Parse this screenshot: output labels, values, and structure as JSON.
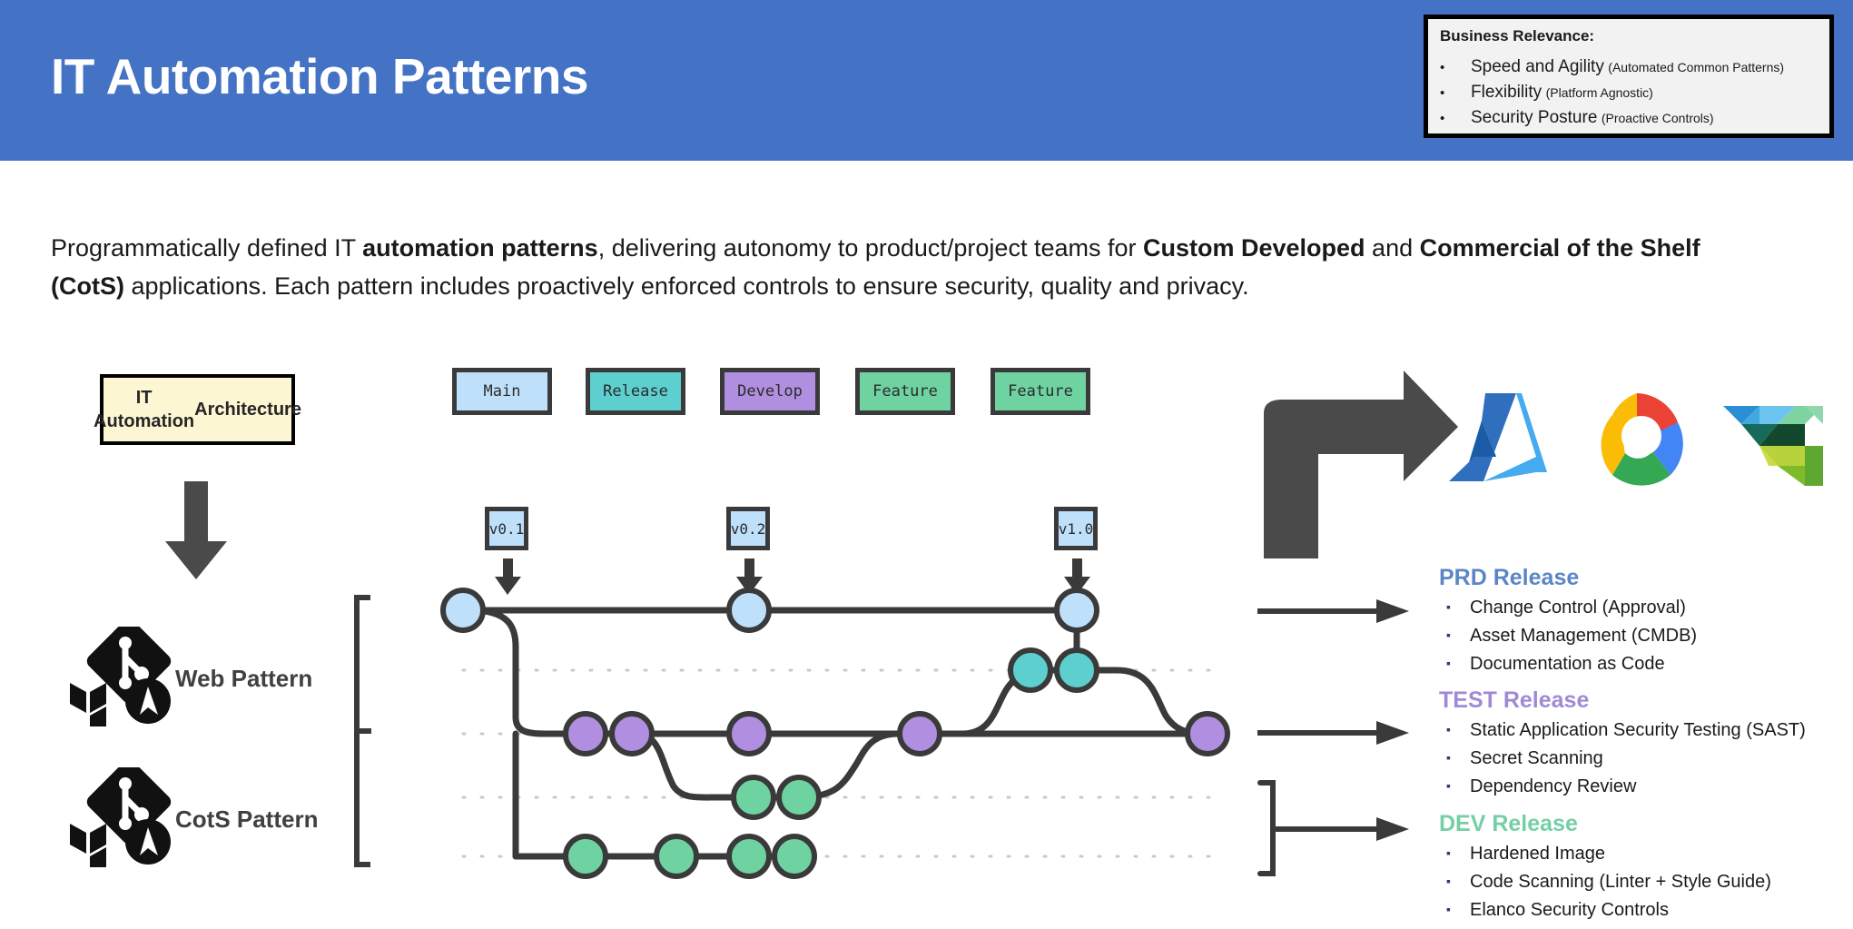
{
  "header": {
    "title": "IT Automation Patterns",
    "bg_color": "#4472c4"
  },
  "business_relevance": {
    "title": "Business Relevance:",
    "items": [
      {
        "bullet": "•",
        "main": "Speed and Agility",
        "sub": "(Automated Common Patterns)"
      },
      {
        "bullet": "•",
        "main": "Flexibility",
        "sub": "(Platform Agnostic)"
      },
      {
        "bullet": "•",
        "main": "Security Posture",
        "sub": "(Proactive Controls)"
      }
    ]
  },
  "intro": {
    "line1_a": "Programmatically defined IT ",
    "line1_b": "automation patterns",
    "line1_c": ", delivering autonomy to product/project teams for ",
    "line1_d": "Custom Developed",
    "line1_e": " and ",
    "line1_f": "Commercial of the Shelf (CotS)",
    "line2": "applications. Each pattern includes proactively enforced controls to ensure security, quality and privacy."
  },
  "architecture": {
    "box_label_line1": "IT Automation",
    "box_label_line2": "Architecture",
    "box_fill": "#fdf6d3",
    "arrow_icon": "down-arrow-icon"
  },
  "patterns": [
    {
      "label": "Web Pattern",
      "icons": [
        "git-logo-icon",
        "terraform-logo-icon",
        "ansible-logo-icon"
      ]
    },
    {
      "label": "CotS Pattern",
      "icons": [
        "git-logo-icon",
        "terraform-logo-icon",
        "ansible-logo-icon"
      ]
    }
  ],
  "branch_legend": [
    {
      "label": "Main",
      "color": "#bfe0fb"
    },
    {
      "label": "Release",
      "color": "#5ecfcf"
    },
    {
      "label": "Develop",
      "color": "#b18fe0"
    },
    {
      "label": "Feature",
      "color": "#6fd3a1"
    },
    {
      "label": "Feature",
      "color": "#6fd3a1"
    }
  ],
  "version_tags": [
    {
      "label": "v0.1"
    },
    {
      "label": "v0.2"
    },
    {
      "label": "v1.0"
    }
  ],
  "git_graph": {
    "lane_colors": {
      "main": "#bfe0fb",
      "release": "#5ecfcf",
      "develop": "#b18fe0",
      "feature": "#6fd3a1"
    },
    "node_stroke": "#3a3a3a",
    "commits": [
      {
        "lane": "main",
        "label": "main-commit-1"
      },
      {
        "lane": "main",
        "label": "main-commit-2"
      },
      {
        "lane": "main",
        "label": "main-commit-3"
      },
      {
        "lane": "release",
        "label": "release-commit-1"
      },
      {
        "lane": "release",
        "label": "release-commit-2"
      },
      {
        "lane": "develop",
        "label": "develop-commit-1"
      },
      {
        "lane": "develop",
        "label": "develop-commit-2"
      },
      {
        "lane": "develop",
        "label": "develop-commit-3"
      },
      {
        "lane": "develop",
        "label": "develop-commit-4"
      },
      {
        "lane": "develop",
        "label": "develop-commit-5"
      },
      {
        "lane": "feature",
        "label": "feature-a-commit-1"
      },
      {
        "lane": "feature",
        "label": "feature-a-commit-2"
      },
      {
        "lane": "feature",
        "label": "feature-b-commit-1"
      },
      {
        "lane": "feature",
        "label": "feature-b-commit-2"
      },
      {
        "lane": "feature",
        "label": "feature-b-commit-3"
      },
      {
        "lane": "feature",
        "label": "feature-b-commit-4"
      }
    ]
  },
  "cloud_targets": [
    {
      "name": "azure-logo-icon"
    },
    {
      "name": "google-cloud-logo-icon"
    },
    {
      "name": "mosaic-triangle-logo-icon"
    }
  ],
  "releases": [
    {
      "title": "PRD Release",
      "color": "#5b86c5",
      "items": [
        "Change Control (Approval)",
        "Asset Management (CMDB)",
        "Documentation as Code"
      ]
    },
    {
      "title": "TEST Release",
      "color": "#9f8ad6",
      "items": [
        "Static Application Security Testing (SAST)",
        "Secret Scanning",
        "Dependency Review"
      ]
    },
    {
      "title": "DEV Release",
      "color": "#73cfa4",
      "items": [
        "Hardened Image",
        "Code Scanning (Linter + Style Guide)",
        "Elanco Security Controls"
      ]
    }
  ]
}
